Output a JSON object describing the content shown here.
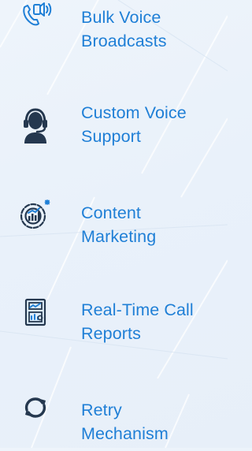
{
  "features": [
    {
      "icon": "voice-broadcast-icon",
      "line1": "Bulk Voice",
      "line2": "Broadcasts"
    },
    {
      "icon": "headset-agent-icon",
      "line1": "Custom Voice",
      "line2": "Support"
    },
    {
      "icon": "content-marketing-icon",
      "line1": "Content",
      "line2": "Marketing"
    },
    {
      "icon": "call-report-icon",
      "line1": "Real-Time Call",
      "line2": "Reports"
    },
    {
      "icon": "retry-icon",
      "line1": "Retry",
      "line2": "Mechanism"
    }
  ],
  "colors": {
    "label": "#1f7fd6",
    "icon_dark": "#25384f",
    "background": "#eaf2fa"
  }
}
